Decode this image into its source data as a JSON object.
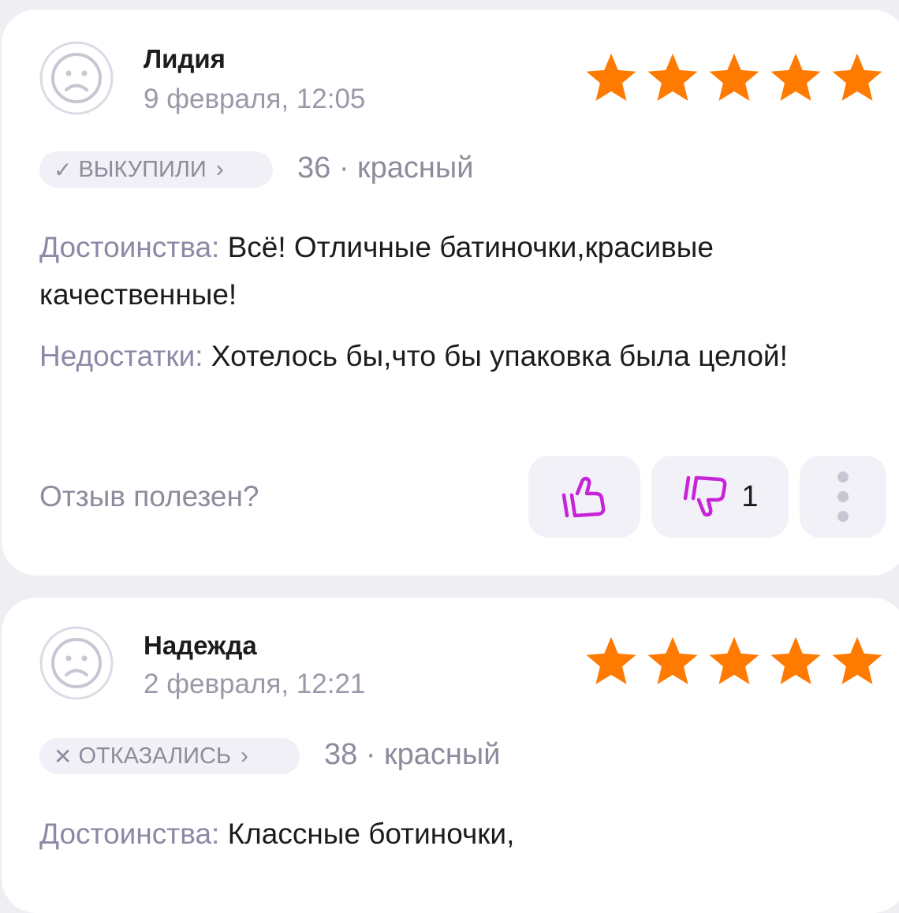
{
  "reviews": [
    {
      "author": "Лидия",
      "date": "9 февраля, 12:05",
      "rating": 5,
      "status": {
        "mark": "✓",
        "label": "ВЫКУПИЛИ",
        "chevron": "›"
      },
      "variant": "36 · красный",
      "pros_label": "Достоинства:",
      "pros_text": " Всё! Отличные батиночки,красивые качественные!",
      "cons_label": "Недостатки:",
      "cons_text": " Хотелось бы,что бы упаковка была целой!",
      "helpful_prompt": "Отзыв полезен?",
      "dislike_count": "1"
    },
    {
      "author": "Надежда",
      "date": "2 февраля, 12:21",
      "rating": 5,
      "status": {
        "mark": "✕",
        "label": "ОТКАЗАЛИСЬ",
        "chevron": "›"
      },
      "variant": "38 · красный",
      "pros_label": "Достоинства:",
      "pros_text": " Классные ботиночки,"
    }
  ],
  "icons": {
    "avatar": "sad-face-avatar-icon",
    "star": "star-icon",
    "like": "thumbs-up-icon",
    "dislike": "thumbs-down-icon",
    "more": "more-vertical-icon"
  },
  "colors": {
    "star": "#ff7a00",
    "accent": "#c724d8",
    "label": "#8d88a6",
    "muted": "#9b99a8",
    "text": "#1c1c1e",
    "chip_bg": "#f1f0f6",
    "page_bg": "#eeeef3"
  }
}
